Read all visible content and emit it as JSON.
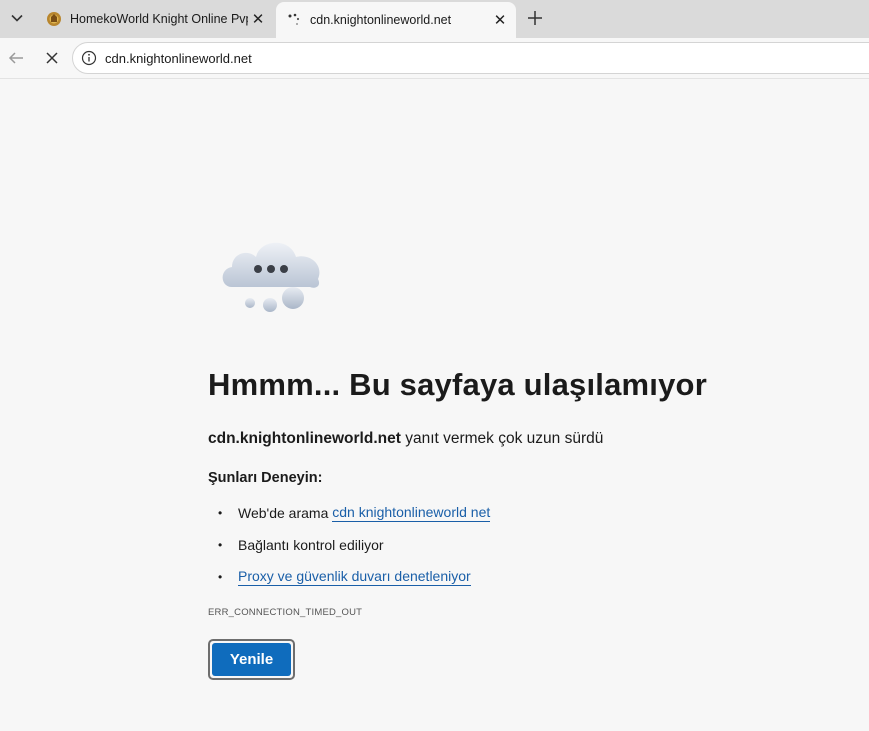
{
  "browser": {
    "tabs": [
      {
        "title": "HomekoWorld Knight Online Pvp S",
        "active": false,
        "favicon": "knight-crest-icon"
      },
      {
        "title": "cdn.knightonlineworld.net",
        "active": true,
        "favicon": "loading-spinner-icon"
      }
    ],
    "address_bar": {
      "url": "cdn.knightonlineworld.net",
      "icon": "info-circle-icon"
    }
  },
  "error_page": {
    "heading": "Hmmm... Bu sayfaya ulaşılamıyor",
    "host": "cdn.knightonlineworld.net",
    "description_rest": " yanıt vermek çok uzun sürdü",
    "try_title": "Şunları Deneyin:",
    "suggestions": [
      {
        "prefix": "Web'de arama ",
        "link": "cdn knightonlineworld net"
      },
      {
        "text": "Bağlantı kontrol ediliyor"
      },
      {
        "link": "Proxy ve güvenlik duvarı denetleniyor"
      }
    ],
    "error_code": "ERR_CONNECTION_TIMED_OUT",
    "reload_label": "Yenile"
  },
  "colors": {
    "accent": "#0f6cbd",
    "link": "#1a5fa8",
    "background": "#f7f7f7"
  }
}
